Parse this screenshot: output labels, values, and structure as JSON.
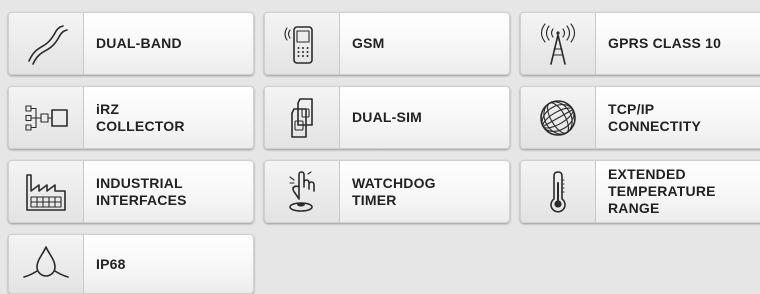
{
  "features": [
    {
      "label": "DUAL-BAND",
      "icon": "dual-band-curve-icon"
    },
    {
      "label": "GSM",
      "icon": "mobile-phone-icon"
    },
    {
      "label": "GPRS CLASS 10",
      "icon": "antenna-tower-icon"
    },
    {
      "label": "iRZ\nCOLLECTOR",
      "icon": "collector-network-icon"
    },
    {
      "label": "DUAL-SIM",
      "icon": "dual-sim-card-icon"
    },
    {
      "label": "TCP/IP\nCONNECTITY",
      "icon": "globe-icon"
    },
    {
      "label": "INDUSTRIAL\nINTERFACES",
      "icon": "factory-icon"
    },
    {
      "label": "WATCHDOG\nTIMER",
      "icon": "pressing-finger-icon"
    },
    {
      "label": "EXTENDED\nTEMPERATURE\nRANGE",
      "icon": "thermometer-icon"
    },
    {
      "label": "IP68",
      "icon": "water-drop-icon"
    }
  ]
}
